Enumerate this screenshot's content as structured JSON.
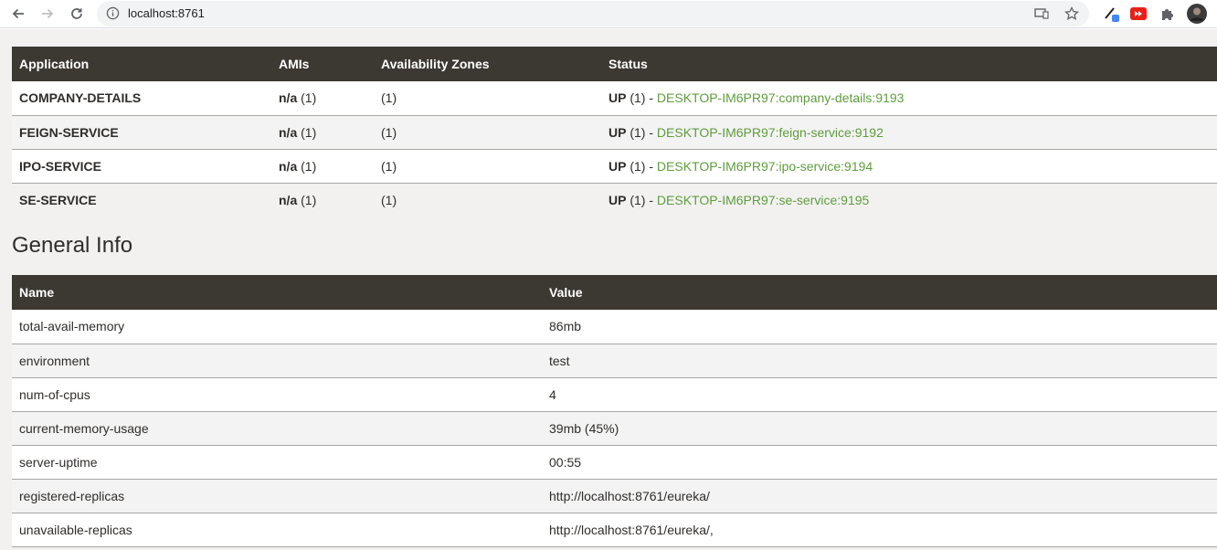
{
  "browser": {
    "url": "localhost:8761",
    "icons": [
      "back-arrow-icon",
      "forward-arrow-icon",
      "reload-icon",
      "info-icon",
      "cast-icon",
      "bookmark-star-icon",
      "eyedropper-extension-icon",
      "youtube-extension-icon",
      "puzzle-extensions-icon",
      "profile-avatar"
    ]
  },
  "apps_section": {
    "headers": [
      "Application",
      "AMIs",
      "Availability Zones",
      "Status"
    ],
    "rows": [
      {
        "application": "COMPANY-DETAILS",
        "amis_na": "n/a",
        "amis_count": " (1)",
        "zones": "(1)",
        "status_up": "UP",
        "status_count": " (1) - ",
        "instance": "DESKTOP-IM6PR97:company-details:9193"
      },
      {
        "application": "FEIGN-SERVICE",
        "amis_na": "n/a",
        "amis_count": " (1)",
        "zones": "(1)",
        "status_up": "UP",
        "status_count": " (1) - ",
        "instance": "DESKTOP-IM6PR97:feign-service:9192"
      },
      {
        "application": "IPO-SERVICE",
        "amis_na": "n/a",
        "amis_count": " (1)",
        "zones": "(1)",
        "status_up": "UP",
        "status_count": " (1) - ",
        "instance": "DESKTOP-IM6PR97:ipo-service:9194"
      },
      {
        "application": "SE-SERVICE",
        "amis_na": "n/a",
        "amis_count": " (1)",
        "zones": "(1)",
        "status_up": "UP",
        "status_count": " (1) - ",
        "instance": "DESKTOP-IM6PR97:se-service:9195"
      }
    ]
  },
  "general_info": {
    "title": "General Info",
    "headers": [
      "Name",
      "Value"
    ],
    "rows": [
      {
        "name": "total-avail-memory",
        "value": "86mb"
      },
      {
        "name": "environment",
        "value": "test"
      },
      {
        "name": "num-of-cpus",
        "value": "4"
      },
      {
        "name": "current-memory-usage",
        "value": "39mb (45%)"
      },
      {
        "name": "server-uptime",
        "value": "00:55"
      },
      {
        "name": "registered-replicas",
        "value": "http://localhost:8761/eureka/"
      },
      {
        "name": "unavailable-replicas",
        "value": "http://localhost:8761/eureka/,"
      }
    ]
  },
  "colors": {
    "header_bg": "#3c3832",
    "link_green": "#5f9d3d",
    "page_bg": "#f2f1f0"
  }
}
